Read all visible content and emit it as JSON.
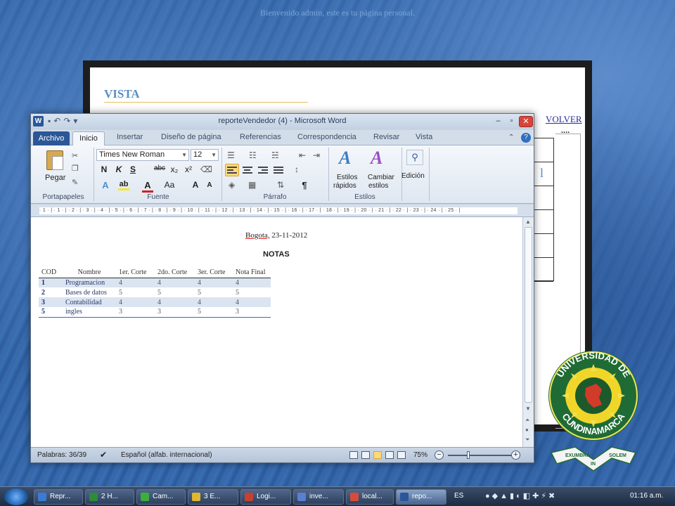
{
  "desktop": {
    "welcome_text": "Bienvenido admin, este es tu página personal."
  },
  "background_page": {
    "title": "VISTA",
    "volver_link": "VOLVER",
    "dots": "....",
    "partial_letter": "l"
  },
  "word": {
    "window_title": "reporteVendedor (4)  -  Microsoft Word",
    "tabs": {
      "file": "Archivo",
      "home": "Inicio",
      "insert": "Insertar",
      "page_design": "Diseño de página",
      "references": "Referencias",
      "mailings": "Correspondencia",
      "review": "Revisar",
      "view": "Vista"
    },
    "ribbon": {
      "clipboard_group": "Portapapeles",
      "paste_label": "Pegar",
      "font_group": "Fuente",
      "font_name": "Times New Roman",
      "font_size": "12",
      "bold": "N",
      "italic": "K",
      "underline": "S",
      "strike": "abc",
      "subscript": "x₂",
      "superscript": "x²",
      "grow_font": "A",
      "shrink_font": "A",
      "change_case": "Aa",
      "paragraph_group": "Párrafo",
      "pilcrow": "¶",
      "styles_group": "Estilos",
      "quick_styles_label": "Estilos",
      "quick_styles_label2": "rápidos",
      "change_styles_label": "Cambiar",
      "change_styles_label2": "estilos",
      "editing_label": "Edición"
    },
    "ruler_text": "· 1 · | · 1 · | · 2 · | · 3 · | · 4 · | · 5 · | · 6 · | · 7 · | · 8 · | · 9 · | · 10 · | · 11 · | · 12 · | · 13 · | · 14 · | · 15 · | · 16 · | · 17 · | · 18 · | · 19 · | · 20 · | · 21 · | · 22 · | · 23 · | · 24 · | · 25 · |",
    "document": {
      "city": "Bogota,",
      "date": " 23-11-2012",
      "heading": "NOTAS",
      "table": {
        "headers": [
          "COD",
          "Nombre",
          "1er. Corte",
          "2do. Corte",
          "3er. Corte",
          "Nota Final"
        ],
        "rows": [
          [
            "1",
            "Programacion",
            "4",
            "4",
            "4",
            "4"
          ],
          [
            "2",
            "Bases de datos",
            "5",
            "5",
            "5",
            "5"
          ],
          [
            "3",
            "Contabilidad",
            "4",
            "4",
            "4",
            "4"
          ],
          [
            "5",
            "ingles",
            "3",
            "3",
            "5",
            "3"
          ]
        ]
      }
    },
    "status": {
      "words": "Palabras: 36/39",
      "language": "Español (alfab. internacional)",
      "zoom": "75%"
    }
  },
  "taskbar": {
    "items": [
      {
        "label": "Repr...",
        "color": "#3a7bd5"
      },
      {
        "label": "2 H...",
        "color": "#2e8b3a"
      },
      {
        "label": "Cam...",
        "color": "#3cae3c"
      },
      {
        "label": "3 E...",
        "color": "#e0b830"
      },
      {
        "label": "Logi...",
        "color": "#c8402e"
      },
      {
        "label": "inve...",
        "color": "#5a7fcf"
      },
      {
        "label": "local...",
        "color": "#d94a3a"
      },
      {
        "label": "repo...",
        "color": "#2b579a"
      }
    ],
    "language": "ES",
    "clock": "01:16 a.m."
  },
  "logo": {
    "text_top": "UNIVERSIDAD DE",
    "text_bottom": "CUNDINAMARCA",
    "banner_left": "EXUMBRA",
    "banner_mid": "IN",
    "banner_right": "SOLEM"
  }
}
